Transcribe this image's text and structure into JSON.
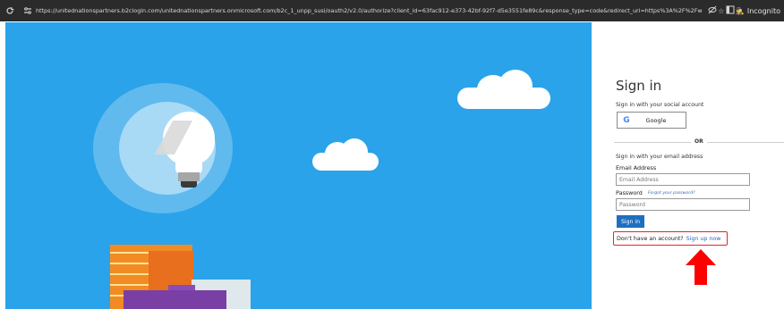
{
  "browser": {
    "reload_icon": "reload-icon",
    "site_info_icon": "site-info-icon",
    "url": "https://unitednationspartners.b2clogin.com/unitednationspartners.onmicrosoft.com/b2c_1_unpp_susi/oauth2/v2.0/authorize?client_id=63fac912-e373-42bf-92f7-d5e3551fe89c&response_type=code&redirect_uri=https%3A%2F%2Fwww.un...",
    "icons": [
      "eye-off-icon",
      "star-icon",
      "sidebar-icon"
    ],
    "incognito_label": "Incognito"
  },
  "signin": {
    "title": "Sign in",
    "social_label": "Sign in with your social account",
    "google_label": "Google",
    "or_label": "OR",
    "email_section_label": "Sign in with your email address",
    "email_label": "Email Address",
    "email_placeholder": "Email Address",
    "password_label": "Password",
    "forgot_label": "Forgot your password?",
    "password_placeholder": "Password",
    "signin_button": "Sign in",
    "no_account_text": "Don't have an account?",
    "signup_link": "Sign up now"
  },
  "colors": {
    "hero_bg": "#2aa3ea",
    "button_blue": "#1e6fbf",
    "highlight_red": "#e52424",
    "link_blue": "#2b68c2"
  }
}
